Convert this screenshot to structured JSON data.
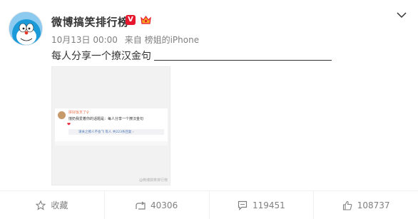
{
  "post": {
    "username": "微博搞笑排行榜",
    "verified_badge": "V",
    "timestamp": "10月13日 00:00",
    "source": "来自 榜姐的iPhone",
    "text": "每人分享一个撩汉金句",
    "image": {
      "comment_user": "拼好饭叉了♀",
      "comment_text": "撞奶我爱着你的话题是：每人分享一个撩汉金句",
      "comment_emoji": "❤",
      "reply_preview": "请关之撩人不会飞 等人  共223条回复 ›",
      "watermark": "@微博搞笑排行榜"
    }
  },
  "actions": {
    "favorite_label": "收藏",
    "repost_count": "40306",
    "comment_count": "119451",
    "like_count": "108737"
  },
  "colors": {
    "verified": "#e6162d",
    "link": "#4f7ab5",
    "meta": "#808080"
  },
  "icons": [
    "doraemon-avatar",
    "verified-v-icon",
    "crown-member-icon",
    "chevron-down-icon",
    "star-icon",
    "repost-icon",
    "comment-icon",
    "thumbs-up-icon"
  ]
}
